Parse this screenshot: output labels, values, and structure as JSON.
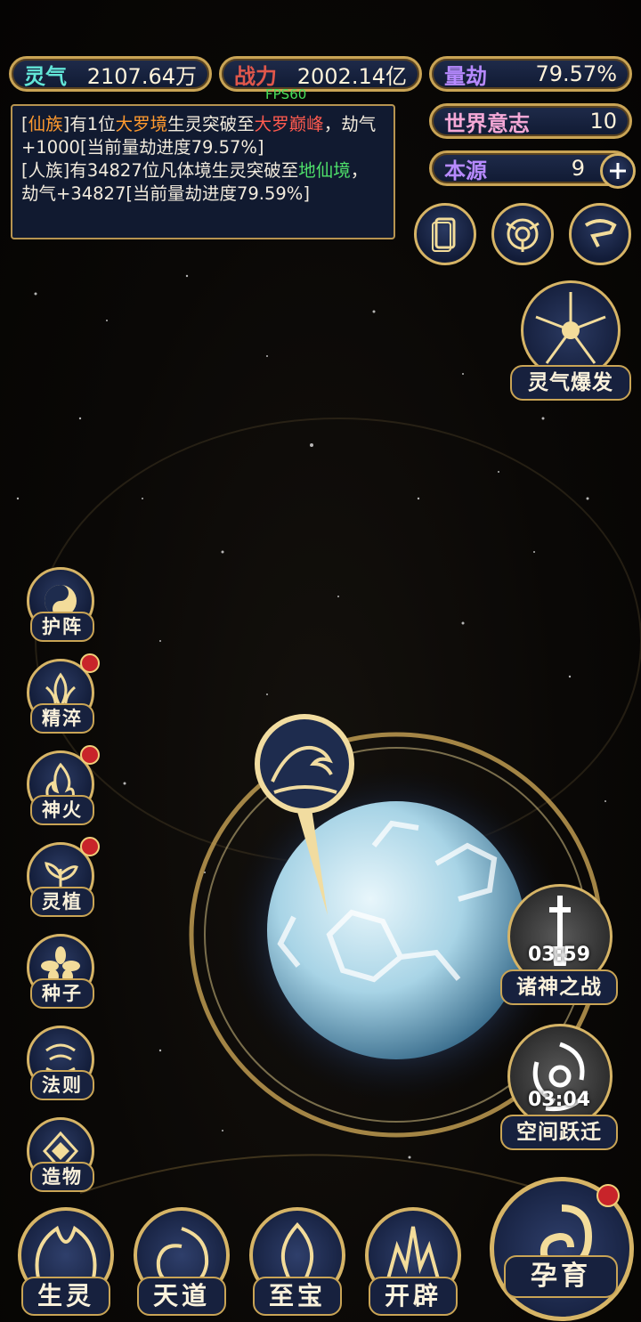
{
  "stats": {
    "lingqi": {
      "label": "灵气",
      "value": "2107.64万"
    },
    "zhanli": {
      "label": "战力",
      "value": "2002.14亿"
    },
    "liangjie": {
      "label": "量劫",
      "value": "79.57%"
    },
    "shijie": {
      "label": "世界意志",
      "value": "10"
    },
    "benyuan": {
      "label": "本源",
      "value": "9"
    }
  },
  "fps": "FPS60",
  "log": {
    "line1": {
      "a": "[",
      "b": "仙族",
      "c": "]有1位",
      "d": "大罗境",
      "e": "生灵突破至",
      "f": "大罗巅峰",
      "g": "，劫气+1000[当前量劫进度79.57%]"
    },
    "line2": {
      "a": "[人族]有34827位凡体境生灵突破至",
      "b": "地仙境",
      "c": "，劫气+34827[当前量劫进度79.59%]"
    }
  },
  "top_icons": [
    "card-icon",
    "vortex-icon",
    "scroll-icon"
  ],
  "burst": {
    "label": "灵气爆发"
  },
  "side_menu": [
    {
      "label": "护阵",
      "icon": "taiji-icon",
      "badge": false
    },
    {
      "label": "精淬",
      "icon": "lotus-flame-icon",
      "badge": true
    },
    {
      "label": "神火",
      "icon": "fire-icon",
      "badge": true
    },
    {
      "label": "灵植",
      "icon": "plant-icon",
      "badge": true
    },
    {
      "label": "种子",
      "icon": "flower-icon",
      "badge": false
    },
    {
      "label": "法则",
      "icon": "rune-icon",
      "badge": false
    },
    {
      "label": "造物",
      "icon": "diamond-icon",
      "badge": false
    }
  ],
  "events": [
    {
      "label": "诸神之战",
      "timer": "03:59"
    },
    {
      "label": "空间跃迁",
      "timer": "03:04"
    }
  ],
  "bottom_nav": [
    {
      "label": "生灵"
    },
    {
      "label": "天道"
    },
    {
      "label": "至宝"
    },
    {
      "label": "开辟"
    },
    {
      "label": "孕育",
      "badge": true
    }
  ],
  "colors": {
    "gold": "#c9a455",
    "panel": "#17213e",
    "planet": "#a8d4e6"
  }
}
